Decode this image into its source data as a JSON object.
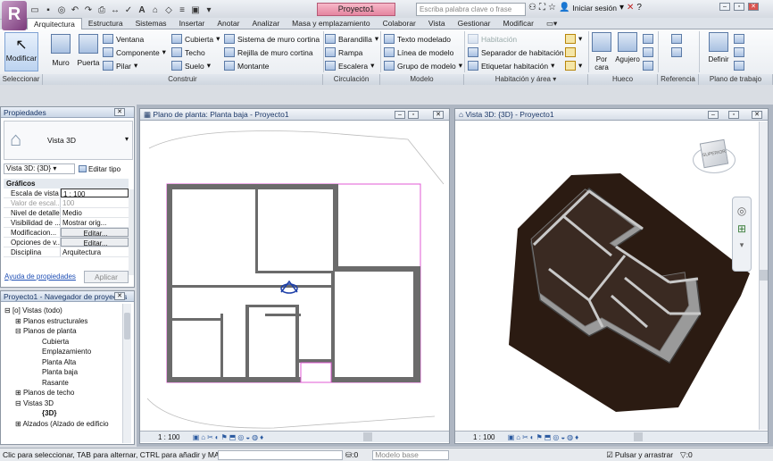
{
  "window": {
    "document_title": "Proyecto1",
    "search_placeholder": "Escriba palabra clave o frase",
    "signin": "Iniciar sesión"
  },
  "tabs": [
    "Arquitectura",
    "Estructura",
    "Sistemas",
    "Insertar",
    "Anotar",
    "Analizar",
    "Masa y emplazamiento",
    "Colaborar",
    "Vista",
    "Gestionar",
    "Modificar"
  ],
  "ribbon": {
    "modify": "Modificar",
    "wall": "Muro",
    "door": "Puerta",
    "window_btn": "Ventana",
    "component": "Componente",
    "pillar": "Pilar",
    "roof": "Cubierta",
    "ceiling": "Techo",
    "floor": "Suelo",
    "curtain_system": "Sistema de muro cortina",
    "curtain_grid": "Rejilla de muro cortina",
    "mullion": "Montante",
    "railing": "Barandilla",
    "ramp": "Rampa",
    "stair": "Escalera",
    "model_text": "Texto modelado",
    "model_line": "Línea de modelo",
    "model_group": "Grupo de modelo",
    "room": "Habitación",
    "room_separator": "Separador de habitación",
    "tag_room": "Etiquetar habitación",
    "by_face": "Por cara",
    "shaft": "Agujero",
    "set": "Definir",
    "groups": {
      "select": "Seleccionar",
      "build": "Construir",
      "circulation": "Circulación",
      "model": "Modelo",
      "room_area": "Habitación y área",
      "opening": "Hueco",
      "datum": "Referencia",
      "work_plane": "Plano de trabajo"
    }
  },
  "properties": {
    "title": "Propiedades",
    "type_name": "Vista 3D",
    "selector": "Vista 3D: {3D}",
    "edit_type": "Editar tipo",
    "section": "Gráficos",
    "help_link": "Ayuda de propiedades",
    "apply": "Aplicar",
    "rows": [
      {
        "k": "Escala de vista",
        "v": "1 : 100"
      },
      {
        "k": "Valor de escal...",
        "v": "100"
      },
      {
        "k": "Nivel de detalle",
        "v": "Medio"
      },
      {
        "k": "Visibilidad de ...",
        "v": "Mostrar orig..."
      },
      {
        "k": "Modificacion...",
        "v": "Editar..."
      },
      {
        "k": "Opciones de v...",
        "v": "Editar..."
      },
      {
        "k": "Disciplina",
        "v": "Arquitectura"
      }
    ]
  },
  "browser": {
    "title": "Proyecto1 - Navegador de proyectos",
    "items": [
      "Vistas (todo)",
      "Planos estructurales",
      "Planos de planta",
      "Cubierta",
      "Emplazamiento",
      "Planta Alta",
      "Planta baja",
      "Rasante",
      "Planos de techo",
      "Vistas 3D",
      "{3D}",
      "Alzados (Alzado de edificio"
    ]
  },
  "plan_view": {
    "title": "Plano de planta: Planta baja - Proyecto1",
    "scale": "1 : 100"
  },
  "view3d": {
    "title": "Vista 3D: {3D} - Proyecto1",
    "scale": "1 : 100",
    "cube_label": "SUPERIOR"
  },
  "status": {
    "hint": "Clic para seleccionar, TAB para alternar, CTRL para añadir y MA",
    "zero": ":0",
    "model": "Modelo base",
    "press_drag": "Pulsar y arrastrar",
    "filter": ":0"
  }
}
